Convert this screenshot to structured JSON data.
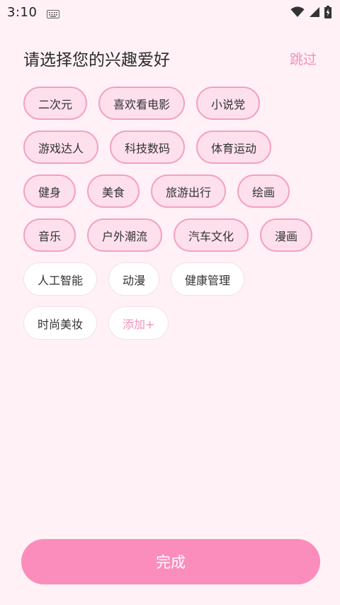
{
  "status_bar": {
    "time": "3:10",
    "icons": [
      "keyboard-icon",
      "wifi-icon",
      "signal-icon",
      "battery-charging-icon"
    ]
  },
  "header": {
    "title": "请选择您的兴趣爱好",
    "skip_label": "跳过"
  },
  "tags": {
    "rows": [
      [
        {
          "label": "二次元",
          "selected": true
        },
        {
          "label": "喜欢看电影",
          "selected": true
        },
        {
          "label": "小说党",
          "selected": true
        }
      ],
      [
        {
          "label": "游戏达人",
          "selected": true
        },
        {
          "label": "科技数码",
          "selected": true
        },
        {
          "label": "体育运动",
          "selected": true
        }
      ],
      [
        {
          "label": "健身",
          "selected": true
        },
        {
          "label": "美食",
          "selected": true
        },
        {
          "label": "旅游出行",
          "selected": true
        },
        {
          "label": "绘画",
          "selected": true
        }
      ],
      [
        {
          "label": "音乐",
          "selected": true
        },
        {
          "label": "户外潮流",
          "selected": true
        },
        {
          "label": "汽车文化",
          "selected": true
        },
        {
          "label": "漫画",
          "selected": true
        }
      ],
      [
        {
          "label": "人工智能",
          "selected": false
        },
        {
          "label": "动漫",
          "selected": false
        },
        {
          "label": "健康管理",
          "selected": false
        }
      ],
      [
        {
          "label": "时尚美妆",
          "selected": false
        },
        {
          "label": "添加+",
          "selected": false,
          "add": true
        }
      ]
    ]
  },
  "footer": {
    "complete_label": "完成"
  },
  "colors": {
    "background": "#fff1f6",
    "accent": "#fb8dbd",
    "selected_fill": "#fde0ec",
    "selected_border": "#f4a0c4",
    "link": "#f48fb8"
  }
}
